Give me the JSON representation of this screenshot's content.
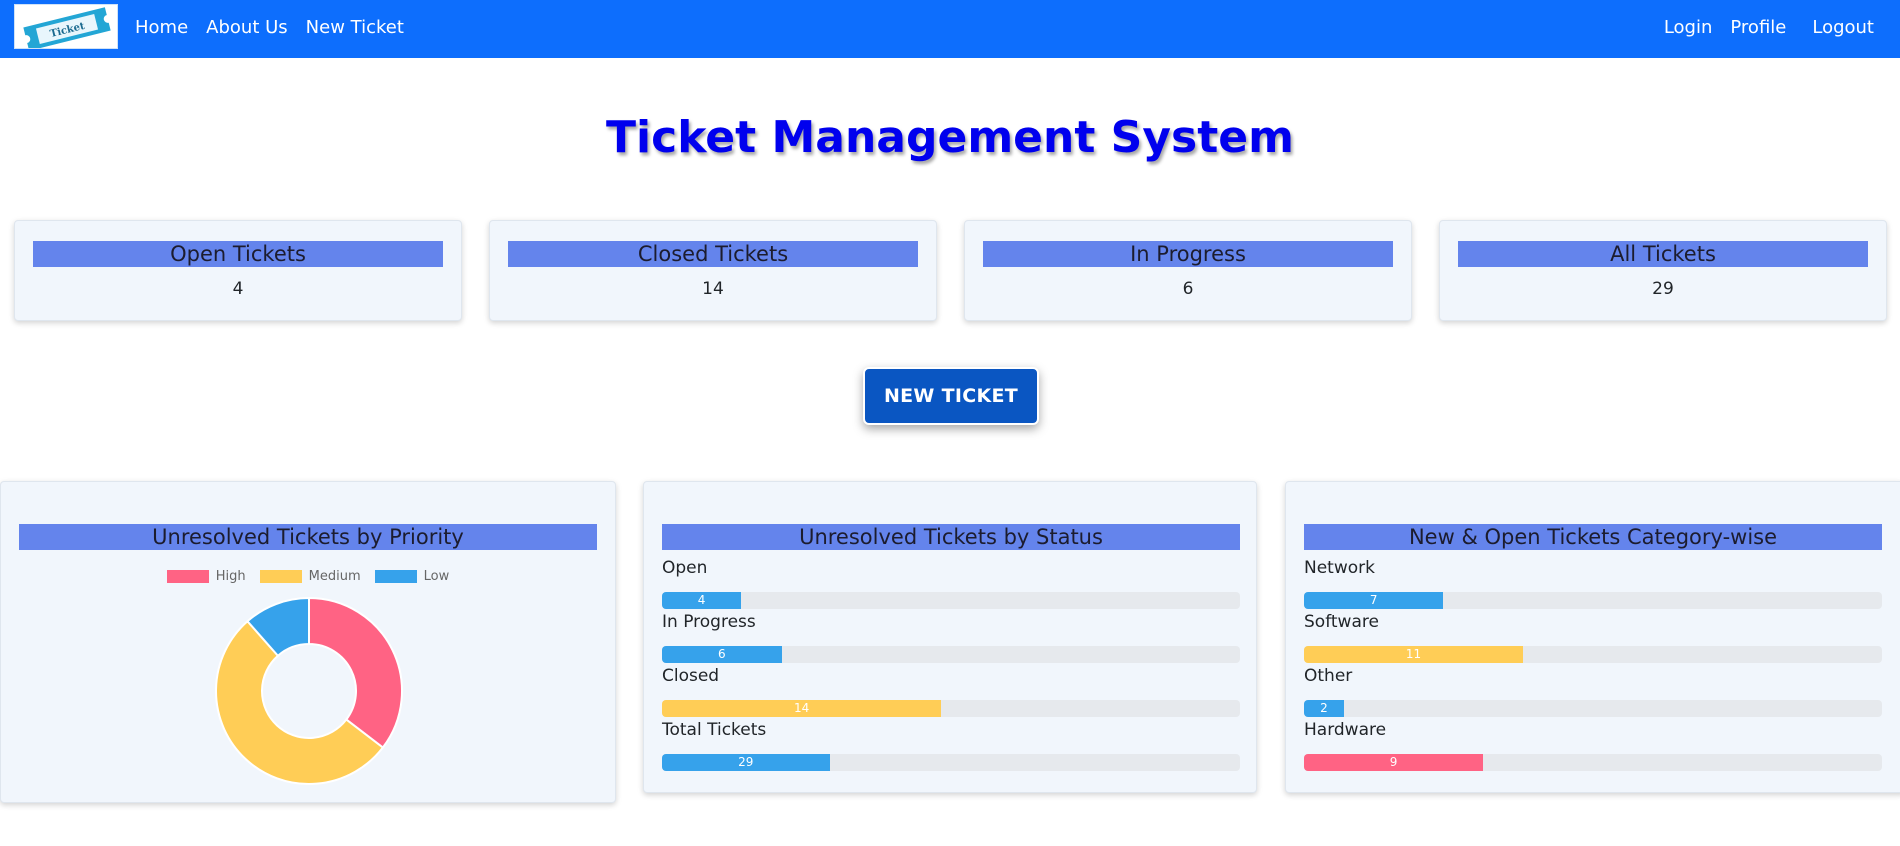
{
  "colors": {
    "navbar": "#0d6efd",
    "title": "#0000ee",
    "card_header": "#6484ec",
    "high": "#ff6384",
    "medium": "#ffcd56",
    "low": "#36a2eb"
  },
  "navbar": {
    "logo_text": "Ticket",
    "left_links": [
      "Home",
      "About Us",
      "New Ticket"
    ],
    "right_links": [
      "Login",
      "Profile",
      "Logout"
    ]
  },
  "page_title": "Ticket Management System",
  "stats": [
    {
      "label": "Open Tickets",
      "value": "4"
    },
    {
      "label": "Closed Tickets",
      "value": "14"
    },
    {
      "label": "In Progress",
      "value": "6"
    },
    {
      "label": "All Tickets",
      "value": "29"
    }
  ],
  "new_ticket_button": "NEW TICKET",
  "priority_panel": {
    "title": "Unresolved Tickets by Priority",
    "chart_data": {
      "type": "pie",
      "variant": "doughnut",
      "legend": "top",
      "series": [
        {
          "name": "High",
          "value": 4,
          "color": "#ff6384"
        },
        {
          "name": "Medium",
          "value": 6,
          "color": "#ffcd56"
        },
        {
          "name": "Low",
          "value": 1.3,
          "color": "#36a2eb"
        }
      ]
    }
  },
  "status_panel": {
    "title": "Unresolved Tickets by Status",
    "max": 60,
    "rows": [
      {
        "label": "Open",
        "value": "4",
        "fraction": 0.137,
        "color": "#36a2eb"
      },
      {
        "label": "In Progress",
        "value": "6",
        "fraction": 0.207,
        "color": "#36a2eb"
      },
      {
        "label": "Closed",
        "value": "14",
        "fraction": 0.483,
        "color": "#ffcd56"
      },
      {
        "label": "Total Tickets",
        "value": "29",
        "fraction": 0.29,
        "color": "#36a2eb"
      }
    ]
  },
  "category_panel": {
    "title": "New & Open Tickets Category-wise",
    "rows": [
      {
        "label": "Network",
        "value": "7",
        "fraction": 0.241,
        "color": "#36a2eb"
      },
      {
        "label": "Software",
        "value": "11",
        "fraction": 0.379,
        "color": "#ffcd56"
      },
      {
        "label": "Other",
        "value": "2",
        "fraction": 0.069,
        "color": "#36a2eb"
      },
      {
        "label": "Hardware",
        "value": "9",
        "fraction": 0.31,
        "color": "#ff6384"
      }
    ]
  }
}
